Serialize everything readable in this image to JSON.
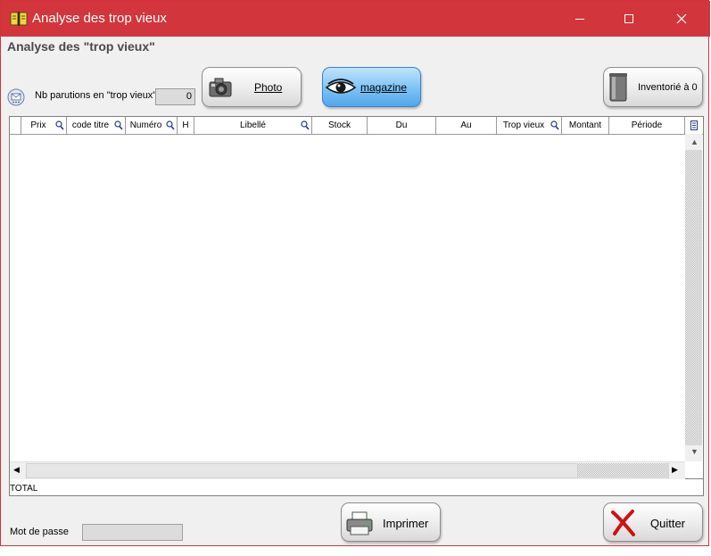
{
  "window": {
    "title": "Analyse des trop vieux"
  },
  "header": {
    "subtitle": "Analyse des \"trop vieux\""
  },
  "toolbar": {
    "nb_label": "Nb parutions en \"trop vieux\"",
    "nb_value": "0",
    "photo_label": "Photo",
    "magazine_label": "magazine",
    "inventorie_label": "Inventorié à 0"
  },
  "table": {
    "columns": [
      "Prix",
      "code titre",
      "Numéro",
      "H",
      "Libellé",
      "Stock",
      "Du",
      "Au",
      "Trop vieux",
      "Montant",
      "Période"
    ],
    "rows": []
  },
  "footer": {
    "total_label": "TOTAL",
    "password_label": "Mot de passe",
    "password_value": "",
    "print_label": "Imprimer",
    "quit_label": "Quitter"
  },
  "colors": {
    "titlebar": "#d2363c",
    "magazine_button": "#7cc2f5"
  }
}
